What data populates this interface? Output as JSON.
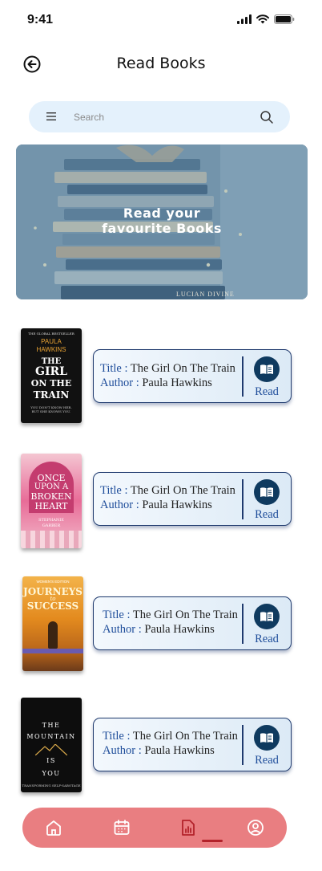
{
  "status_bar": {
    "time": "9:41"
  },
  "header": {
    "title": "Read Books"
  },
  "search": {
    "placeholder": "Search"
  },
  "banner": {
    "line1": "Read your",
    "line2": "favourite Books",
    "spine_text": "LUCIAN DIVINE"
  },
  "books": [
    {
      "title_label": "Title :",
      "title": "The Girl On The Train",
      "author_label": "Author :",
      "author": "Paula Hawkins",
      "action": "Read",
      "cover": {
        "top": "THE GLOBAL BESTSELLER",
        "author": "PAULA HAWKINS",
        "title1": "THE",
        "title2": "GIRL",
        "title3": "ON THE",
        "title4": "TRAIN",
        "tagline": "YOU DON'T KNOW HER. BUT SHE KNOWS YOU."
      }
    },
    {
      "title_label": "Title :",
      "title": "The Girl On The Train",
      "author_label": "Author :",
      "author": "Paula Hawkins",
      "action": "Read",
      "cover": {
        "title1": "ONCE",
        "title2": "UPON A",
        "title3": "BROKEN",
        "title4": "HEART",
        "author": "STEPHANIE GARBER"
      }
    },
    {
      "title_label": "Title :",
      "title": "The Girl On The Train",
      "author_label": "Author :",
      "author": "Paula Hawkins",
      "action": "Read",
      "cover": {
        "edition": "WOMEN'S EDITION",
        "title1": "JOURNEYS",
        "title2": "to",
        "title3": "SUCCESS"
      }
    },
    {
      "title_label": "Title :",
      "title": "The Girl On The Train",
      "author_label": "Author :",
      "author": "Paula Hawkins",
      "action": "Read",
      "cover": {
        "title1": "THE",
        "title2": "MOUNTAIN",
        "title3": "IS",
        "title4": "YOU",
        "subtitle": "TRANSFORMING SELF-SABOTAGE"
      }
    }
  ],
  "nav": {
    "items": [
      "home-icon",
      "calendar-icon",
      "report-icon",
      "profile-icon"
    ],
    "active_index": 2
  },
  "colors": {
    "accent": "#1e4d9a",
    "nav_bg": "#e97e81",
    "search_bg": "#e4f1fc",
    "read_icon_bg": "#0f3a5f"
  }
}
